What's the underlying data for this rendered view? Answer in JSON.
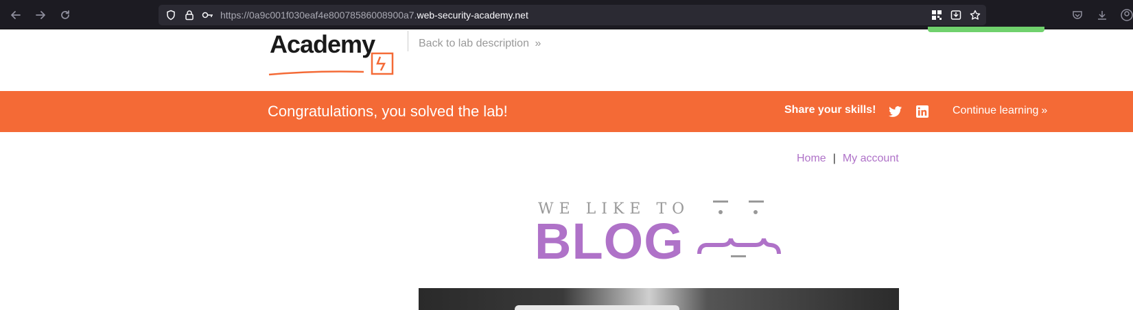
{
  "browser": {
    "url_prefix": "https://0a9c001f030eaf4e80078586008900a7.",
    "url_domain": "web-security-academy.net",
    "icons": [
      "back-icon",
      "forward-icon",
      "reload-icon",
      "shield-icon",
      "lock-icon",
      "key-icon",
      "qr-icon",
      "reader-icon",
      "star-icon",
      "pocket-icon",
      "download-icon",
      "account-icon"
    ]
  },
  "header": {
    "logo_text": "Academy",
    "back_link": "Back to lab description",
    "back_link_arrow": "»"
  },
  "banner": {
    "message": "Congratulations, you solved the lab!",
    "share_label": "Share your skills!",
    "continue_label": "Continue learning",
    "continue_arrow": "»",
    "color": "#f46a36"
  },
  "nav": {
    "home": "Home",
    "separator": "|",
    "my_account": "My account",
    "link_color": "#af72c8"
  },
  "blog_logo": {
    "tagline": "WE LIKE TO",
    "word": "BLOG"
  }
}
